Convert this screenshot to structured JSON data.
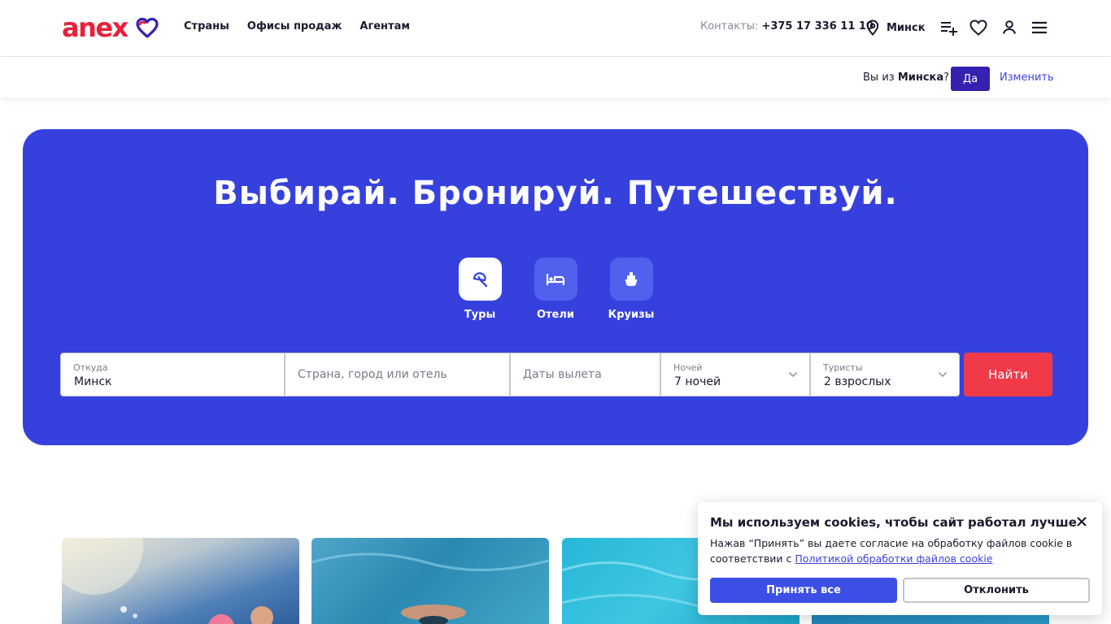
{
  "brand": {
    "logo_text": "anex",
    "logo_color": "#e8213a",
    "heart_color": "#3521b0"
  },
  "nav": {
    "items": [
      "Страны",
      "Офисы продаж",
      "Агентам"
    ]
  },
  "header": {
    "contacts_label": "Контакты:",
    "phone": "+375 17 336 11 10",
    "city": "Минск",
    "icons": [
      "location-pin-icon",
      "playlist-add-icon",
      "heart-icon",
      "user-icon",
      "menu-icon"
    ]
  },
  "city_confirm": {
    "prefix": "Вы из ",
    "city": "Минска",
    "suffix": "?",
    "yes_label": "Да",
    "change_label": "Изменить"
  },
  "hero": {
    "title": "Выбирай. Бронируй. Путешествуй.",
    "bg_color": "#3641dd",
    "modes": [
      {
        "label": "Туры",
        "icon": "beach-umbrella-icon",
        "active": true
      },
      {
        "label": "Отели",
        "icon": "bed-icon",
        "active": false
      },
      {
        "label": "Круизы",
        "icon": "ship-icon",
        "active": false
      }
    ]
  },
  "search": {
    "from_label": "Откуда",
    "from_value": "Минск",
    "destination_placeholder": "Страна, город или отель",
    "dates_placeholder": "Даты вылета",
    "nights_label": "Ночей",
    "nights_value": "7 ночей",
    "tourists_label": "Туристы",
    "tourists_value": "2 взрослых",
    "find_label": "Найти",
    "find_color": "#f03a4a"
  },
  "cookie": {
    "title": "Мы используем cookies, чтобы сайт работал лучше",
    "text": "Нажав “Принять” вы даете согласие на обработку файлов cookie в соответствии с ",
    "policy_link": "Политикой обработки файлов cookie",
    "accept_label": "Принять все",
    "decline_label": "Отклонить"
  }
}
